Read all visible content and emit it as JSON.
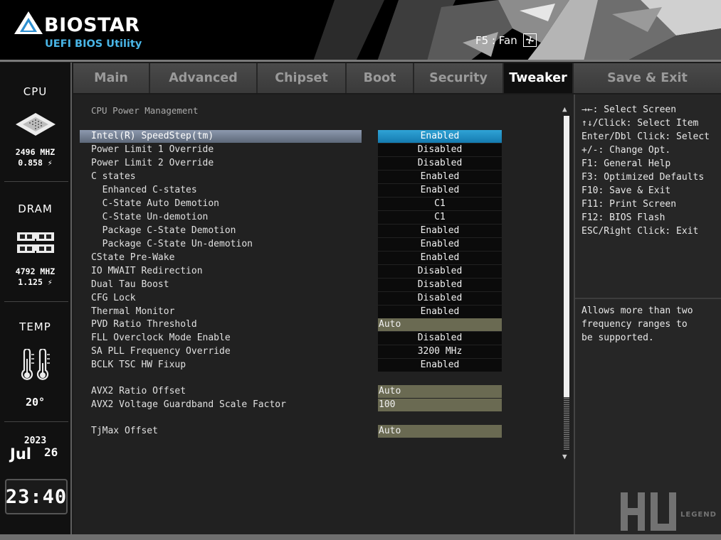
{
  "header": {
    "brand": "BIOSTAR",
    "subtitle": "UEFI BIOS Utility",
    "fan_shortcut": "F5 : Fan"
  },
  "side_panel": {
    "cpu_title": "CPU",
    "cpu_freq": "2496 MHZ",
    "cpu_volt": "0.858 ⚡",
    "dram_title": "DRAM",
    "dram_freq": "4792 MHZ",
    "dram_volt": "1.125 ⚡",
    "temp_title": "TEMP",
    "temp_value": "20°",
    "year": "2023",
    "month": "Jul",
    "day": "26",
    "time_hour": "23",
    "time_min": "40"
  },
  "tabs": [
    {
      "label": "Main"
    },
    {
      "label": "Advanced"
    },
    {
      "label": "Chipset"
    },
    {
      "label": "Boot"
    },
    {
      "label": "Security"
    },
    {
      "label": "Tweaker"
    },
    {
      "label": "Save & Exit"
    }
  ],
  "main": {
    "section_title": "CPU Power Management",
    "settings": [
      {
        "label": "Intel(R) SpeedStep(tm)",
        "value": "Enabled"
      },
      {
        "label": "Power Limit 1 Override",
        "value": "Disabled"
      },
      {
        "label": "Power Limit 2 Override",
        "value": "Disabled"
      },
      {
        "label": "C states",
        "value": "Enabled"
      },
      {
        "label": "  Enhanced C-states",
        "value": "Enabled"
      },
      {
        "label": "  C-State Auto Demotion",
        "value": "C1"
      },
      {
        "label": "  C-State Un-demotion",
        "value": "C1"
      },
      {
        "label": "  Package C-State Demotion",
        "value": "Enabled"
      },
      {
        "label": "  Package C-State Un-demotion",
        "value": "Enabled"
      },
      {
        "label": "CState Pre-Wake",
        "value": "Enabled"
      },
      {
        "label": "IO MWAIT Redirection",
        "value": "Disabled"
      },
      {
        "label": "Dual Tau Boost",
        "value": "Disabled"
      },
      {
        "label": "CFG Lock",
        "value": "Disabled"
      },
      {
        "label": "Thermal Monitor",
        "value": "Enabled"
      },
      {
        "label": "PVD Ratio Threshold",
        "value": "Auto"
      },
      {
        "label": "FLL Overclock Mode Enable",
        "value": "Disabled"
      },
      {
        "label": "SA PLL Frequency Override",
        "value": "3200 MHz"
      },
      {
        "label": "BCLK TSC HW Fixup",
        "value": "Enabled"
      },
      {
        "label": "AVX2 Ratio Offset",
        "value": "Auto"
      },
      {
        "label": "AVX2 Voltage Guardband Scale Factor",
        "value": "100"
      },
      {
        "label": "TjMax Offset",
        "value": "Auto"
      }
    ]
  },
  "help": {
    "keys": [
      "→←: Select Screen",
      "↑↓/Click: Select Item",
      "Enter/Dbl Click: Select",
      "+/-: Change Opt.",
      "F1: General Help",
      "F3: Optimized Defaults",
      "F10: Save & Exit",
      "F11: Print Screen",
      "F12: BIOS Flash",
      "ESC/Right Click: Exit"
    ],
    "description": [
      "Allows more than two",
      "frequency ranges to",
      "be supported."
    ]
  },
  "watermark": {
    "text": "LEGEND"
  },
  "colors": {
    "accent_blue": "#2fa3d6",
    "selected_row": "#7c889c",
    "numeric_field": "#6a6a52"
  },
  "icons": [
    "fan-icon",
    "cpu-chip-icon",
    "dram-module-icon",
    "thermometer-icon"
  ]
}
